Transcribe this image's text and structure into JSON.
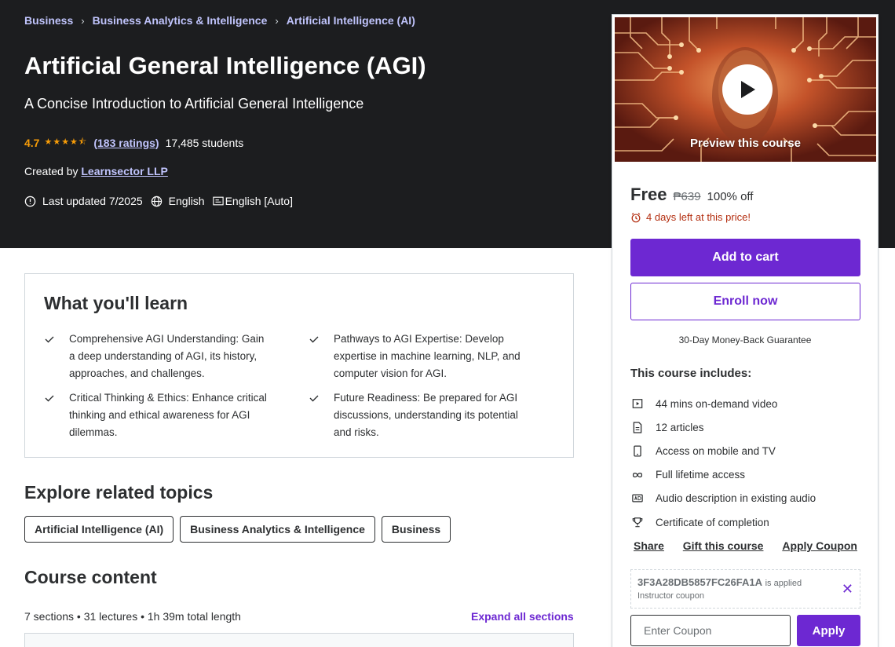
{
  "breadcrumb": [
    "Business",
    "Business Analytics & Intelligence",
    "Artificial Intelligence (AI)"
  ],
  "course": {
    "title": "Artificial General Intelligence (AGI)",
    "subtitle": "A Concise Introduction to Artificial General Intelligence",
    "rating": "4.7",
    "rating_stars": 4.5,
    "ratings_count": "(183 ratings)",
    "students": "17,485 students",
    "created_by_label": "Created by",
    "author": "Learnsector LLP",
    "last_updated": "Last updated 7/2025",
    "language": "English",
    "captions": "English [Auto]"
  },
  "sidebar": {
    "preview_label": "Preview this course",
    "price": "Free",
    "original_price": "₱639",
    "discount": "100% off",
    "deadline": "4 days left at this price!",
    "add_to_cart": "Add to cart",
    "enroll": "Enroll now",
    "guarantee": "30-Day Money-Back Guarantee",
    "includes_title": "This course includes:",
    "includes": [
      {
        "icon": "video-icon",
        "label": "44 mins on-demand video"
      },
      {
        "icon": "article-icon",
        "label": "12 articles"
      },
      {
        "icon": "mobile-icon",
        "label": "Access on mobile and TV"
      },
      {
        "icon": "infinity-icon",
        "label": "Full lifetime access"
      },
      {
        "icon": "audio-description-icon",
        "label": "Audio description in existing audio"
      },
      {
        "icon": "trophy-icon",
        "label": "Certificate of completion"
      }
    ],
    "links": {
      "share": "Share",
      "gift": "Gift this course",
      "apply_coupon": "Apply Coupon"
    },
    "coupon": {
      "code": "3F3A28DB5857FC26FA1A",
      "applied_text": "is applied",
      "sub": "Instructor coupon",
      "input_placeholder": "Enter Coupon",
      "apply": "Apply"
    }
  },
  "learn": {
    "title": "What you'll learn",
    "items": [
      "Comprehensive AGI Understanding: Gain a deep understanding of AGI, its history, approaches, and challenges.",
      "Pathways to AGI Expertise: Develop expertise in machine learning, NLP, and computer vision for AGI.",
      "Critical Thinking & Ethics: Enhance critical thinking and ethical awareness for AGI dilemmas.",
      "Future Readiness: Be prepared for AGI discussions, understanding its potential and risks."
    ]
  },
  "explore": {
    "title": "Explore related topics",
    "topics": [
      "Artificial Intelligence (AI)",
      "Business Analytics & Intelligence",
      "Business"
    ]
  },
  "content": {
    "title": "Course content",
    "meta": "7 sections • 31 lectures • 1h 39m total length",
    "expand": "Expand all sections"
  },
  "colors": {
    "hero_bg": "#1c1d1f",
    "accent": "#6d28d2",
    "link_light": "#c0c4fc",
    "star": "#f69c08",
    "deadline": "#b32d0f"
  }
}
